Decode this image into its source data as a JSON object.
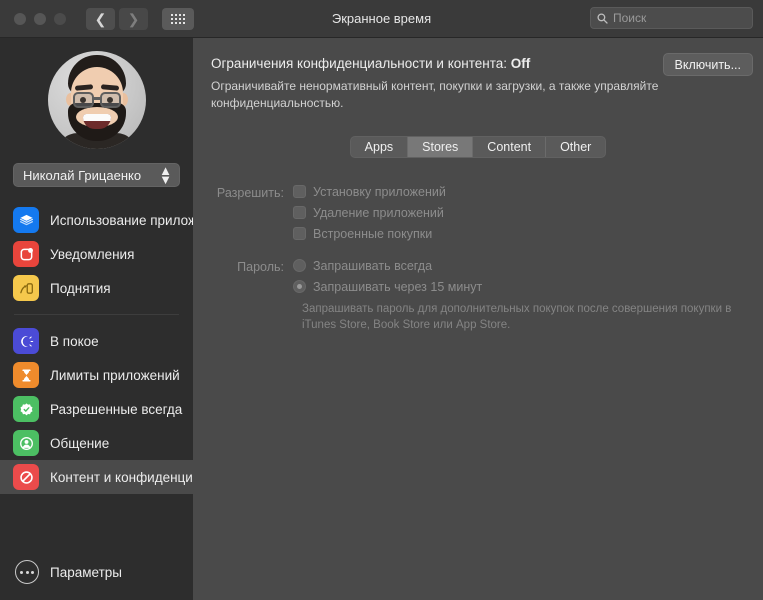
{
  "window": {
    "title": "Экранное время",
    "traffic_lights": [
      "close",
      "minimize",
      "zoom"
    ],
    "nav": {
      "back_icon": "chevron-left-icon",
      "forward_icon": "chevron-right-icon",
      "grid_icon": "grid-icon"
    }
  },
  "search": {
    "placeholder": "Поиск",
    "icon": "search-icon"
  },
  "sidebar": {
    "avatar": "memoji-avatar",
    "user_popup": {
      "value": "Николай Грицаенко",
      "icon": "chevron-up-down-icon"
    },
    "groups": [
      {
        "items": [
          {
            "label": "Использование прилож",
            "icon": "app-usage-icon",
            "color": "#1479ef",
            "selected": false
          },
          {
            "label": "Уведомления",
            "icon": "notifications-icon",
            "color": "#e8453c",
            "selected": false
          },
          {
            "label": "Поднятия",
            "icon": "pickups-icon",
            "color": "#f5c84c",
            "selected": false
          }
        ]
      },
      {
        "items": [
          {
            "label": "В покое",
            "icon": "downtime-icon",
            "color": "#4b4bd6",
            "selected": false
          },
          {
            "label": "Лимиты приложений",
            "icon": "app-limits-icon",
            "color": "#ef8b2c",
            "selected": false
          },
          {
            "label": "Разрешенные всегда",
            "icon": "always-allowed-icon",
            "color": "#4cbf63",
            "selected": false
          },
          {
            "label": "Общение",
            "icon": "communication-icon",
            "color": "#4cbf63",
            "selected": false
          },
          {
            "label": "Контент и конфиденциа",
            "icon": "content-privacy-icon",
            "color": "#eb4b4b",
            "selected": true
          }
        ]
      }
    ],
    "options": {
      "label": "Параметры",
      "icon": "options-icon"
    }
  },
  "main": {
    "heading_prefix": "Ограничения конфиденциальности и контента: ",
    "heading_status": "Off",
    "description": "Ограничивайте ненормативный контент, покупки и загрузки, а также управляйте конфиденциальностью.",
    "enable_button": "Включить...",
    "tabs": [
      {
        "label": "Apps",
        "active": false
      },
      {
        "label": "Stores",
        "active": true
      },
      {
        "label": "Content",
        "active": false
      },
      {
        "label": "Other",
        "active": false
      }
    ],
    "allow_group": {
      "title": "Разрешить:",
      "checkboxes": [
        {
          "label": "Установку приложений",
          "checked": false,
          "disabled": true
        },
        {
          "label": "Удаление приложений",
          "checked": false,
          "disabled": true
        },
        {
          "label": "Встроенные покупки",
          "checked": false,
          "disabled": true
        }
      ]
    },
    "password_group": {
      "title": "Пароль:",
      "radios": [
        {
          "label": "Запрашивать всегда",
          "selected": false,
          "disabled": true
        },
        {
          "label": "Запрашивать через 15 минут",
          "selected": true,
          "disabled": true
        }
      ],
      "hint": "Запрашивать пароль для дополнительных покупок после совершения покупки в iTunes Store, Book Store или App Store."
    }
  },
  "colors": {
    "sidebar_bg": "#2d2d2d",
    "main_bg": "#4a4a4a",
    "titlebar_bg": "#3a3a3a",
    "selected_row": "#4a4a4a"
  }
}
